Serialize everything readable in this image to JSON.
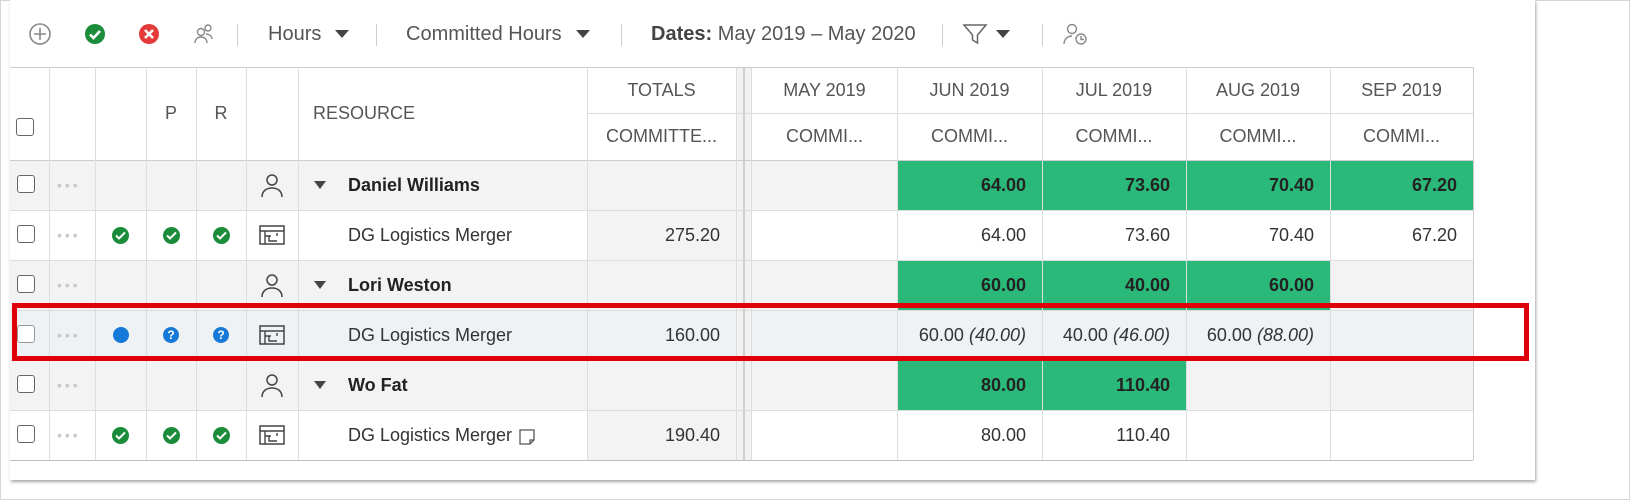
{
  "toolbar": {
    "view_label": "Hours",
    "measure_label": "Committed Hours",
    "dates_label": "Dates:",
    "dates_value": "May 2019 – May 2020"
  },
  "columns": {
    "p": "P",
    "r": "R",
    "resource": "RESOURCE",
    "totals": "TOTALS",
    "totals_sub": "COMMITTE...",
    "months": [
      "MAY 2019",
      "JUN 2019",
      "JUL 2019",
      "AUG 2019",
      "SEP 2019"
    ],
    "month_sub": "COMMI..."
  },
  "rows": [
    {
      "type": "resource",
      "name": "Daniel Williams",
      "total": "",
      "months": [
        "",
        "64.00",
        "73.60",
        "70.40",
        "67.20"
      ]
    },
    {
      "type": "project",
      "name": "DG Logistics Merger",
      "total": "275.20",
      "months": [
        "",
        "64.00",
        "73.60",
        "70.40",
        "67.20"
      ],
      "requested": [
        "",
        "",
        "",
        "",
        ""
      ]
    },
    {
      "type": "resource",
      "name": "Lori Weston",
      "total": "",
      "months": [
        "",
        "60.00",
        "40.00",
        "60.00",
        ""
      ]
    },
    {
      "type": "project",
      "name": "DG Logistics Merger",
      "total": "160.00",
      "months": [
        "",
        "60.00",
        "40.00",
        "60.00",
        ""
      ],
      "requested": [
        "",
        "(40.00)",
        "(46.00)",
        "(88.00)",
        ""
      ]
    },
    {
      "type": "resource",
      "name": "Wo Fat",
      "total": "",
      "months": [
        "",
        "80.00",
        "110.40",
        "",
        ""
      ]
    },
    {
      "type": "project",
      "name": "DG Logistics Merger",
      "total": "190.40",
      "months": [
        "",
        "80.00",
        "110.40",
        "",
        ""
      ],
      "requested": [
        "",
        "",
        "",
        "",
        ""
      ]
    }
  ],
  "colors": {
    "committed_green": "#2bb97a",
    "highlight_red": "#e0000a",
    "approve_green": "#1a8c3a",
    "pending_blue": "#1679d8"
  }
}
